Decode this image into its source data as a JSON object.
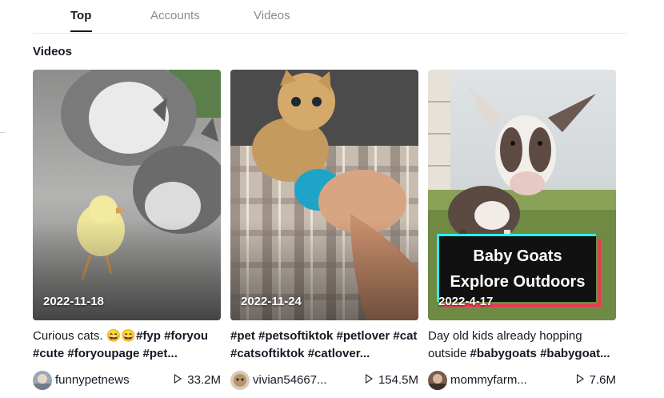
{
  "tabs": [
    {
      "label": "Top",
      "active": true
    },
    {
      "label": "Accounts",
      "active": false
    },
    {
      "label": "Videos",
      "active": false
    }
  ],
  "section_title": "Videos",
  "cards": [
    {
      "date": "2022-11-18",
      "caption_text": "Curious cats. 😄😄",
      "caption_tags": "#fyp #foryou #cute #foryoupage #pet...",
      "author": "funnypetnews",
      "plays": "33.2M"
    },
    {
      "date": "2022-11-24",
      "caption_text": "",
      "caption_tags": "#pet #petsoftiktok #petlover #cat #catsoftiktok #catlover...",
      "author": "vivian54667...",
      "plays": "154.5M"
    },
    {
      "date": "2022-4-17",
      "caption_text": "Day old kids already hopping outside ",
      "caption_tags": "#babygoats #babygoat...",
      "author": "mommyfarm...",
      "plays": "7.6M",
      "overlay_line1": "Baby Goats",
      "overlay_line2": "Explore Outdoors"
    }
  ],
  "colors": {
    "accent_cyan": "#25f4ee",
    "accent_red": "#fe2c55",
    "text": "#161823",
    "muted": "#8a8b91"
  }
}
